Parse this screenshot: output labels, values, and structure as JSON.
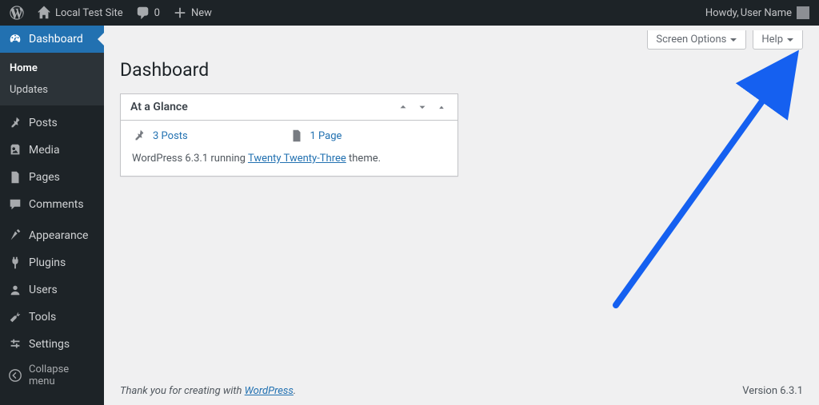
{
  "adminbar": {
    "site_name": "Local Test Site",
    "comments_count": "0",
    "new_label": "New",
    "howdy_prefix": "Howdy, ",
    "user_name": "User Name"
  },
  "sidebar": {
    "items": [
      {
        "id": "dashboard",
        "label": "Dashboard"
      },
      {
        "id": "posts",
        "label": "Posts"
      },
      {
        "id": "media",
        "label": "Media"
      },
      {
        "id": "pages",
        "label": "Pages"
      },
      {
        "id": "comments",
        "label": "Comments"
      },
      {
        "id": "appearance",
        "label": "Appearance"
      },
      {
        "id": "plugins",
        "label": "Plugins"
      },
      {
        "id": "users",
        "label": "Users"
      },
      {
        "id": "tools",
        "label": "Tools"
      },
      {
        "id": "settings",
        "label": "Settings"
      },
      {
        "id": "collapse",
        "label": "Collapse menu"
      }
    ],
    "submenu": {
      "home": "Home",
      "updates": "Updates"
    }
  },
  "screen_meta": {
    "screen_options": "Screen Options",
    "help": "Help"
  },
  "page": {
    "title": "Dashboard"
  },
  "at_a_glance": {
    "title": "At a Glance",
    "posts_count": "3 Posts",
    "pages_count": "1 Page",
    "wp_text_prefix": "WordPress 6.3.1 running ",
    "theme_link": "Twenty Twenty-Three",
    "wp_text_suffix": " theme."
  },
  "footer": {
    "text_prefix": "Thank you for creating with ",
    "link": "WordPress",
    "text_suffix": ".",
    "version": "Version 6.3.1"
  }
}
